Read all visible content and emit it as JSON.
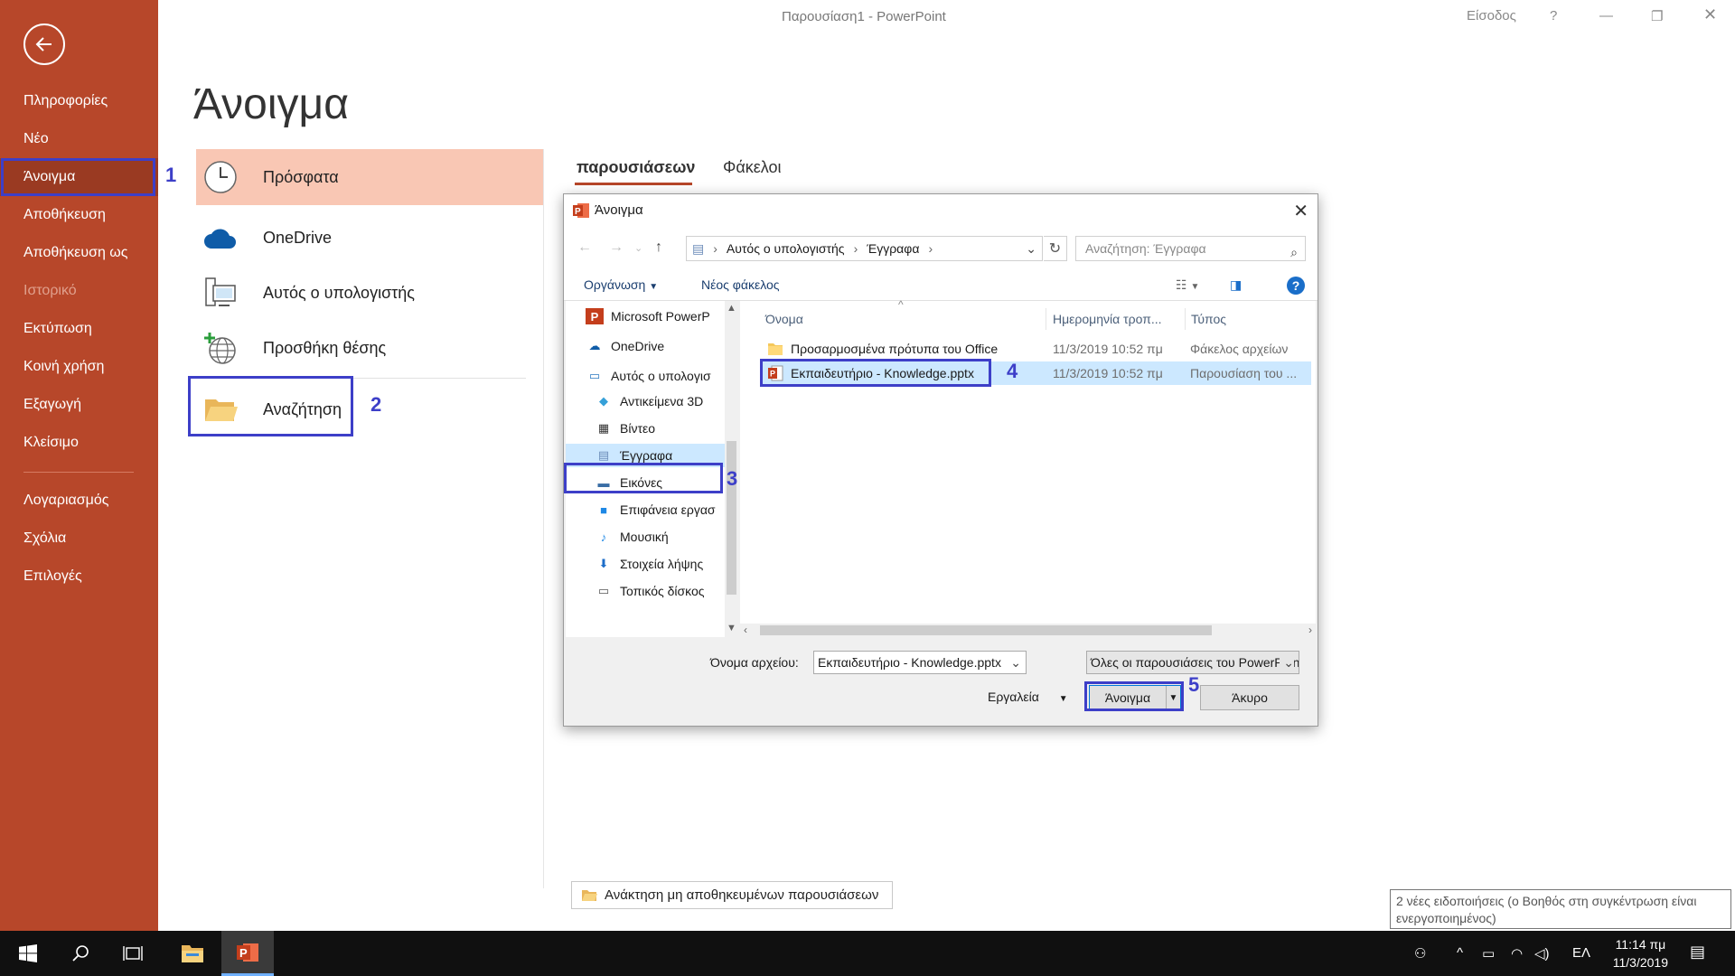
{
  "window": {
    "title": "Παρουσίαση1 - PowerPoint",
    "signin": "Είσοδος",
    "help": "?"
  },
  "nav": {
    "items": [
      {
        "label": "Πληροφορίες"
      },
      {
        "label": "Νέο"
      },
      {
        "label": "Άνοιγμα"
      },
      {
        "label": "Αποθήκευση"
      },
      {
        "label": "Αποθήκευση ως"
      },
      {
        "label": "Ιστορικό"
      },
      {
        "label": "Εκτύπωση"
      },
      {
        "label": "Κοινή χρήση"
      },
      {
        "label": "Εξαγωγή"
      },
      {
        "label": "Κλείσιμο"
      },
      {
        "label": "Λογαριασμός"
      },
      {
        "label": "Σχόλια"
      },
      {
        "label": "Επιλογές"
      }
    ]
  },
  "steps": [
    "1",
    "2",
    "3",
    "4",
    "5"
  ],
  "page": {
    "title": "Άνοιγμα",
    "locations": [
      {
        "label": "Πρόσφατα"
      },
      {
        "label": "OneDrive"
      },
      {
        "label": "Αυτός ο υπολογιστής"
      },
      {
        "label": "Προσθήκη θέσης"
      },
      {
        "label": "Αναζήτηση"
      }
    ],
    "tabs": [
      {
        "label": "παρουσιάσεων"
      },
      {
        "label": "Φάκελοι"
      }
    ],
    "recover_label": "Ανάκτηση μη αποθηκευμένων παρουσιάσεων"
  },
  "dialog": {
    "title": "Άνοιγμα",
    "breadcrumb": [
      "Αυτός ο υπολογιστής",
      "Έγγραφα"
    ],
    "search_placeholder": "Αναζήτηση: Έγγραφα",
    "organize": "Οργάνωση",
    "new_folder": "Νέος φάκελος",
    "tree": [
      {
        "label": "Microsoft PowerP",
        "icon": "powerpoint-icon"
      },
      {
        "label": "OneDrive",
        "icon": "cloud-icon"
      },
      {
        "label": "Αυτός ο υπολογισ",
        "icon": "computer-icon"
      },
      {
        "label": "Αντικείμενα 3D",
        "icon": "cube-icon"
      },
      {
        "label": "Βίντεο",
        "icon": "video-icon"
      },
      {
        "label": "Έγγραφα",
        "icon": "document-icon"
      },
      {
        "label": "Εικόνες",
        "icon": "pictures-icon"
      },
      {
        "label": "Επιφάνεια εργασ",
        "icon": "desktop-icon"
      },
      {
        "label": "Μουσική",
        "icon": "music-icon"
      },
      {
        "label": "Στοιχεία λήψης",
        "icon": "download-icon"
      },
      {
        "label": "Τοπικός δίσκος",
        "icon": "disk-icon"
      }
    ],
    "columns": {
      "name": "Όνομα",
      "date": "Ημερομηνία τροπ...",
      "type": "Τύπος"
    },
    "files": [
      {
        "name": "Προσαρμοσμένα πρότυπα του Office",
        "date": "11/3/2019 10:52 πμ",
        "type": "Φάκελος αρχείων",
        "icon": "folder-icon"
      },
      {
        "name": "Εκπαιδευτήριο - Knowledge.pptx",
        "date": "11/3/2019 10:52 πμ",
        "type": "Παρουσίαση του ...",
        "icon": "pptx-icon"
      }
    ],
    "filename_label": "Όνομα αρχείου:",
    "filename_value": "Εκπαιδευτήριο - Knowledge.pptx",
    "filetype_value": "Όλες οι παρουσιάσεις του PowerPoint",
    "tools": "Εργαλεία",
    "open": "Άνοιγμα",
    "cancel": "Άκυρο"
  },
  "tooltip": "2 νέες ειδοποιήσεις (ο Βοηθός στη συγκέντρωση είναι ενεργοποιημένος)",
  "taskbar": {
    "lang": "ΕΛ",
    "time": "11:14 πμ",
    "date": "11/3/2019"
  },
  "colors": {
    "accent": "#b7472a",
    "highlight": "#3d3fc8",
    "selected": "#cce8ff"
  }
}
